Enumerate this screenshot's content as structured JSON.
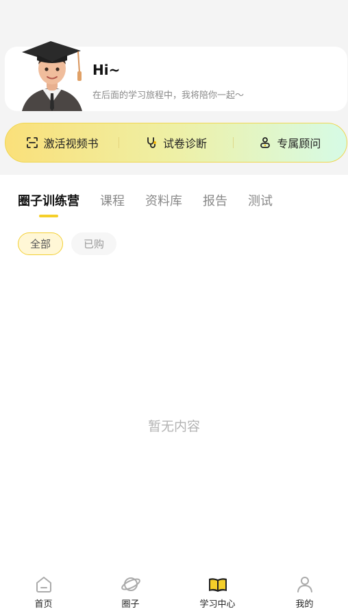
{
  "profile": {
    "greeting": "Hi~",
    "subtitle": "在后面的学习旅程中，我将陪你一起～"
  },
  "quick_actions": [
    {
      "label": "激活视频书",
      "icon": "scan-icon"
    },
    {
      "label": "试卷诊断",
      "icon": "stethoscope-icon"
    },
    {
      "label": "专属顾问",
      "icon": "advisor-icon"
    }
  ],
  "tabs": [
    "圈子训练营",
    "课程",
    "资料库",
    "报告",
    "测试"
  ],
  "active_tab": "圈子训练营",
  "filters": [
    "全部",
    "已购"
  ],
  "active_filter": "全部",
  "empty_text": "暂无内容",
  "bottom_nav": [
    {
      "label": "首页",
      "icon": "home-icon"
    },
    {
      "label": "圈子",
      "icon": "planet-icon"
    },
    {
      "label": "学习中心",
      "icon": "open-book-icon",
      "active": true
    },
    {
      "label": "我的",
      "icon": "profile-icon"
    }
  ],
  "colors": {
    "accent": "#f5cf29",
    "quick_bar_gradient": [
      "#fae07a",
      "#d6fbe6"
    ]
  }
}
